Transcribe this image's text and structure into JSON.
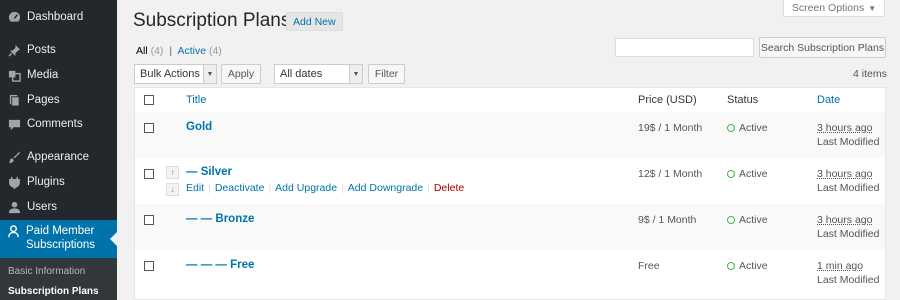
{
  "sidebar": {
    "items": [
      {
        "label": "Dashboard",
        "icon": "dashboard-icon"
      },
      {
        "label": "Posts",
        "icon": "pin-icon"
      },
      {
        "label": "Media",
        "icon": "media-icon"
      },
      {
        "label": "Pages",
        "icon": "pages-icon"
      },
      {
        "label": "Comments",
        "icon": "comment-icon"
      },
      {
        "label": "Appearance",
        "icon": "brush-icon"
      },
      {
        "label": "Plugins",
        "icon": "plug-icon"
      },
      {
        "label": "Users",
        "icon": "user-icon"
      },
      {
        "label": "Paid Member Subscriptions",
        "icon": "member-icon"
      }
    ],
    "submenu": [
      "Basic Information",
      "Subscription Plans"
    ]
  },
  "header": {
    "title": "Subscription Plans",
    "add_new": "Add New",
    "screen_options": "Screen Options"
  },
  "filters": {
    "all_label": "All",
    "all_count": "(4)",
    "separator": "|",
    "active_label": "Active",
    "active_count": "(4)",
    "bulk_actions": "Bulk Actions",
    "apply": "Apply",
    "dates": "All dates",
    "filter": "Filter",
    "search_button": "Search Subscription Plans",
    "items_count": "4 items"
  },
  "table": {
    "columns": {
      "title": "Title",
      "price": "Price (USD)",
      "status": "Status",
      "date": "Date"
    },
    "rows": [
      {
        "title": "Gold",
        "price": "19$ / 1 Month",
        "status": "Active",
        "date": "3 hours ago",
        "date_note": "Last Modified"
      },
      {
        "title": "— Silver",
        "price": "12$ / 1 Month",
        "status": "Active",
        "date": "3 hours ago",
        "date_note": "Last Modified"
      },
      {
        "title": "— — Bronze",
        "price": "9$ / 1 Month",
        "status": "Active",
        "date": "3 hours ago",
        "date_note": "Last Modified"
      },
      {
        "title": "— — — Free",
        "price": "Free",
        "status": "Active",
        "date": "1 min ago",
        "date_note": "Last Modified"
      }
    ],
    "row_actions": {
      "edit": "Edit",
      "deactivate": "Deactivate",
      "add_upgrade": "Add Upgrade",
      "add_downgrade": "Add Downgrade",
      "delete": "Delete",
      "sep": "|"
    },
    "arrows": {
      "up": "↑",
      "down": "↓"
    }
  },
  "colors": {
    "accent": "#0073aa",
    "sidebar": "#23282d",
    "active_status": "#46b450",
    "delete": "#a00"
  }
}
